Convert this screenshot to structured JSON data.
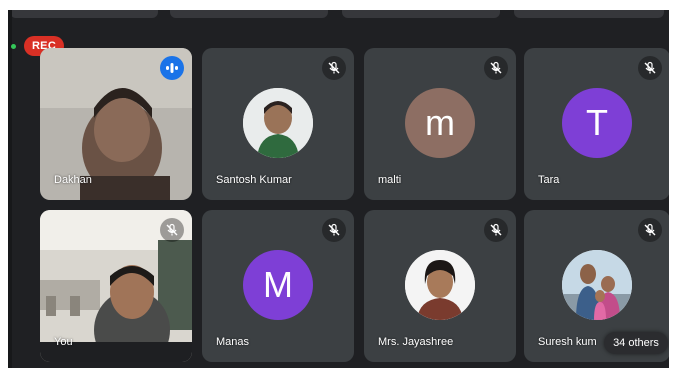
{
  "recording": {
    "label": "REC",
    "color": "#d93025"
  },
  "participants": [
    {
      "name": "Dakhan",
      "tile_type": "video",
      "mic": "speaking"
    },
    {
      "name": "Santosh Kumar",
      "tile_type": "photo-avatar",
      "mic": "muted"
    },
    {
      "name": "malti",
      "tile_type": "letter-avatar",
      "initial": "m",
      "avatar_color": "#8d6e63",
      "mic": "muted"
    },
    {
      "name": "Tara",
      "tile_type": "letter-avatar",
      "initial": "T",
      "avatar_color": "#7e3fd6",
      "mic": "muted"
    },
    {
      "name": "You",
      "tile_type": "video",
      "mic": "muted"
    },
    {
      "name": "Manas",
      "tile_type": "letter-avatar",
      "initial": "M",
      "avatar_color": "#7e3fd6",
      "mic": "muted"
    },
    {
      "name": "Mrs. Jayashree",
      "tile_type": "photo-avatar",
      "mic": "muted"
    },
    {
      "name": "Suresh kum",
      "tile_type": "photo-avatar",
      "mic": "muted"
    }
  ],
  "others": {
    "label": "34 others"
  },
  "icons": {
    "muted": "mic-off-icon",
    "speaking": "speaking-indicator-icon"
  }
}
